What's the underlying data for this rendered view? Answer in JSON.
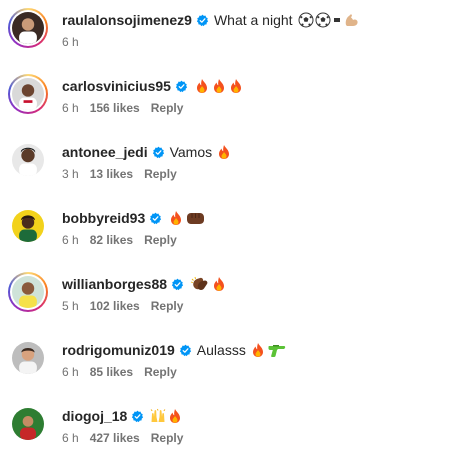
{
  "comments": [
    {
      "username": "raulalonsojimenez9",
      "text": "What a night",
      "emojis": [
        "soccer-ball-icon",
        "soccer-ball-icon",
        "small-square-icon",
        "flexed-biceps-icon"
      ],
      "time": "6 h",
      "likes": "",
      "reply": "",
      "story_ring": true
    },
    {
      "username": "carlosvinicius95",
      "text": "",
      "emojis": [
        "fire-icon",
        "fire-icon",
        "fire-icon"
      ],
      "time": "6 h",
      "likes": "156 likes",
      "reply": "Reply",
      "story_ring": true
    },
    {
      "username": "antonee_jedi",
      "text": "Vamos",
      "emojis": [
        "fire-icon"
      ],
      "time": "3 h",
      "likes": "13 likes",
      "reply": "Reply",
      "story_ring": false
    },
    {
      "username": "bobbyreid93",
      "text": "",
      "emojis": [
        "fire-icon",
        "fist-icon"
      ],
      "time": "6 h",
      "likes": "82 likes",
      "reply": "Reply",
      "story_ring": false
    },
    {
      "username": "willianborges88",
      "text": "",
      "emojis": [
        "clapping-hands-icon",
        "fire-icon"
      ],
      "time": "5 h",
      "likes": "102 likes",
      "reply": "Reply",
      "story_ring": true
    },
    {
      "username": "rodrigomuniz019",
      "text": "Aulasss",
      "emojis": [
        "fire-icon",
        "water-pistol-icon"
      ],
      "time": "6 h",
      "likes": "85 likes",
      "reply": "Reply",
      "story_ring": false
    },
    {
      "username": "diogoj_18",
      "text": "",
      "emojis": [
        "raising-hands-icon",
        "fire-icon"
      ],
      "time": "6 h",
      "likes": "427 likes",
      "reply": "Reply",
      "story_ring": false
    }
  ],
  "colors": {
    "verified": "#0095f6",
    "meta_text": "#737373",
    "username": "#262626"
  },
  "icons": {
    "verified": "verified-badge-icon"
  }
}
